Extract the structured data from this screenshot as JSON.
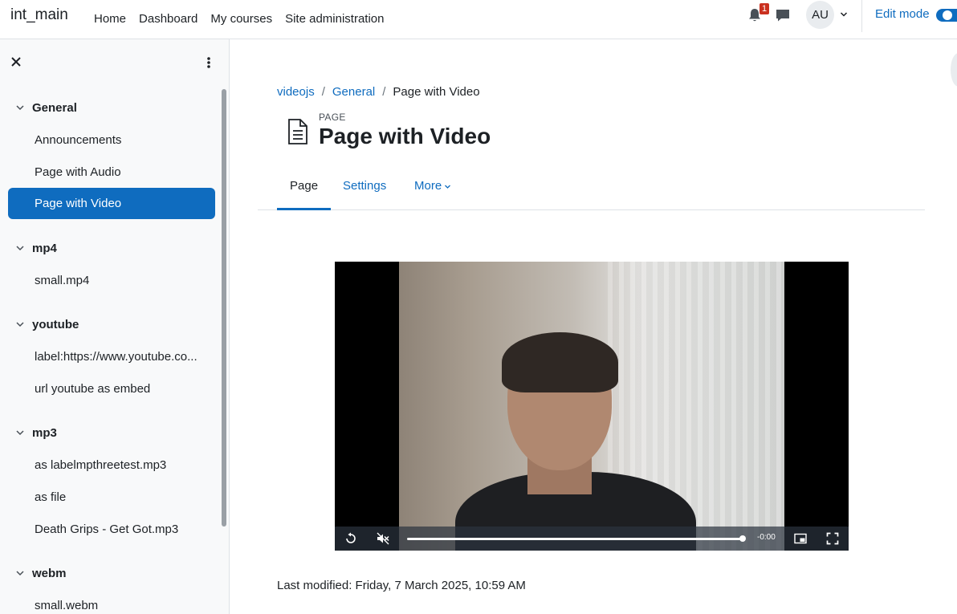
{
  "navbar": {
    "brand": "int_main",
    "links": [
      "Home",
      "Dashboard",
      "My courses",
      "Site administration"
    ],
    "notification_count": "1",
    "avatar_initials": "AU",
    "edit_mode_label": "Edit mode"
  },
  "drawer": {
    "sections": [
      {
        "title": "General",
        "items": [
          "Announcements",
          "Page with Audio",
          "Page with Video"
        ]
      },
      {
        "title": "mp4",
        "items": [
          "small.mp4"
        ]
      },
      {
        "title": "youtube",
        "items": [
          "label:https://www.youtube.co...",
          "url youtube as embed"
        ]
      },
      {
        "title": "mp3",
        "items": [
          "as labelmpthreetest.mp3",
          "as file",
          "Death Grips - Get Got.mp3"
        ]
      },
      {
        "title": "webm",
        "items": [
          "small.webm"
        ]
      }
    ],
    "active_item": "Page with Video"
  },
  "breadcrumb": [
    "videojs",
    "General",
    "Page with Video"
  ],
  "page": {
    "type_label": "PAGE",
    "title": "Page with Video"
  },
  "tabs": [
    "Page",
    "Settings",
    "More"
  ],
  "video": {
    "time_remaining": "-0:00",
    "progress_fraction": 1.0
  },
  "last_modified": "Last modified: Friday, 7 March 2025, 10:59 AM"
}
